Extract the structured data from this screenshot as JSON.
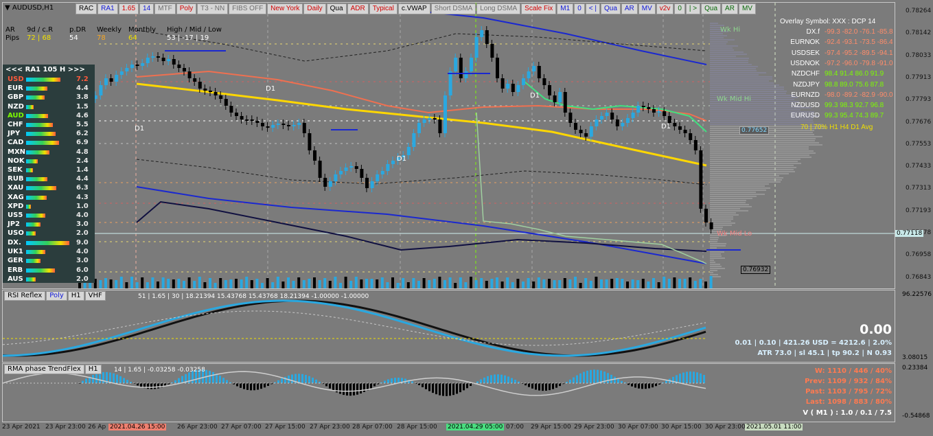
{
  "window": {
    "symbol": "AUDUSD,H1"
  },
  "toolbar": [
    {
      "label": "RAC",
      "style": ""
    },
    {
      "label": "RA1",
      "style": "blue"
    },
    {
      "label": "1.65",
      "style": "red"
    },
    {
      "label": "14",
      "style": "blue"
    },
    {
      "label": "MTF",
      "style": "grey"
    },
    {
      "label": "Poly",
      "style": "red"
    },
    {
      "label": "T3 - NN",
      "style": "grey"
    },
    {
      "label": "FIBS OFF",
      "style": "grey"
    },
    {
      "label": "New York",
      "style": "red"
    },
    {
      "label": "Daily",
      "style": "red"
    },
    {
      "label": "Qua",
      "style": ""
    },
    {
      "label": "ADR",
      "style": "red"
    },
    {
      "label": "Typical",
      "style": "red"
    },
    {
      "label": "c.VWAP",
      "style": ""
    },
    {
      "label": "Short DSMA",
      "style": "grey"
    },
    {
      "label": "Long DSMA",
      "style": "grey"
    },
    {
      "label": "Scale Fix",
      "style": "red"
    },
    {
      "label": "M1",
      "style": "blue"
    },
    {
      "label": "0",
      "style": "blue"
    },
    {
      "label": "< |",
      "style": "blue"
    },
    {
      "label": "Qua",
      "style": "blue"
    },
    {
      "label": "AR",
      "style": "blue"
    },
    {
      "label": "MV",
      "style": "blue"
    },
    {
      "label": "v2v",
      "style": "red"
    },
    {
      "label": "0",
      "style": "green"
    },
    {
      "label": "| >",
      "style": "green"
    },
    {
      "label": "Qua",
      "style": "green"
    },
    {
      "label": "AR",
      "style": "green"
    },
    {
      "label": "MV",
      "style": "green"
    }
  ],
  "stats": {
    "ar_label": "AR",
    "pips_label": "Pips",
    "col1_head": "9d / c.R",
    "col1_val": "72 | 68",
    "col2_head": "p.DR",
    "col2_val": "54",
    "col3_head": "Weekly",
    "col3_val": "78",
    "col4_head": "Monthly",
    "col4_val": "64",
    "col5_head": "High / Mid / Low",
    "col5_val": "53  |  -17  |  19"
  },
  "strength": {
    "header": "<<<   RA1   105   H   >>>",
    "rows": [
      {
        "name": "USD",
        "value": "7.2",
        "style": "red",
        "fill": 0.72
      },
      {
        "name": "EUR",
        "value": "4.4",
        "style": "",
        "fill": 0.44
      },
      {
        "name": "GBP",
        "value": "3.8",
        "style": "",
        "fill": 0.38
      },
      {
        "name": "NZD",
        "value": "1.5",
        "style": "",
        "fill": 0.15
      },
      {
        "name": "AUD",
        "value": "4.6",
        "style": "green",
        "fill": 0.46
      },
      {
        "name": "CHF",
        "value": "5.5",
        "style": "",
        "fill": 0.55
      },
      {
        "name": "JPY",
        "value": "6.2",
        "style": "",
        "fill": 0.62
      },
      {
        "name": "CAD",
        "value": "6.9",
        "style": "",
        "fill": 0.69
      },
      {
        "name": "MXN",
        "value": "4.8",
        "style": "",
        "fill": 0.48
      },
      {
        "name": "NOK",
        "value": "2.4",
        "style": "",
        "fill": 0.24
      },
      {
        "name": "SEK",
        "value": "1.4",
        "style": "",
        "fill": 0.14
      },
      {
        "name": "RUB",
        "value": "4.4",
        "style": "",
        "fill": 0.44
      },
      {
        "name": "XAU",
        "value": "6.3",
        "style": "",
        "fill": 0.63
      },
      {
        "name": "XAG",
        "value": "4.3",
        "style": "",
        "fill": 0.43
      },
      {
        "name": "XPD",
        "value": "1.0",
        "style": "",
        "fill": 0.1
      },
      {
        "name": "US5",
        "value": "4.0",
        "style": "",
        "fill": 0.4
      },
      {
        "name": "JP2",
        "value": "3.0",
        "style": "",
        "fill": 0.3
      },
      {
        "name": "USO",
        "value": "2.0",
        "style": "",
        "fill": 0.2
      },
      {
        "name": "DX.",
        "value": "9.0",
        "style": "",
        "fill": 0.9
      },
      {
        "name": "UK1",
        "value": "4.0",
        "style": "",
        "fill": 0.4
      },
      {
        "name": "GER",
        "value": "3.0",
        "style": "",
        "fill": 0.3
      },
      {
        "name": "ERB",
        "value": "6.0",
        "style": "",
        "fill": 0.6
      },
      {
        "name": "AUS",
        "value": "2.0",
        "style": "",
        "fill": 0.2
      }
    ]
  },
  "overlay": {
    "title": "Overlay Symbol: XXX : DCP 14",
    "rows": [
      {
        "name": "DX.f",
        "vals": "-99.3  -82.0  -76.1  -85.8",
        "color": "#ff8c6a"
      },
      {
        "name": "EURNOK",
        "vals": "-92.4  -93.1  -73.5  -86.4",
        "color": "#ff8c6a"
      },
      {
        "name": "USDSEK",
        "vals": "-97.4  -95.2  -89.5  -94.1",
        "color": "#ff8c6a"
      },
      {
        "name": "USDNOK",
        "vals": "-97.2  -96.0  -79.8  -91.0",
        "color": "#ff8c6a"
      },
      {
        "name": "NZDCHF",
        "vals": "98.4  91.4  86.0  91.9",
        "color": "#7cfc00"
      },
      {
        "name": "NZDJPY",
        "vals": "98.8  89.0  75.6  87.8",
        "color": "#7cfc00"
      },
      {
        "name": "EURNZD",
        "vals": "-98.0  -89.2  -82.9  -90.0",
        "color": "#ff8c6a"
      },
      {
        "name": "NZDUSD",
        "vals": "99.3  98.3  92.7  96.8",
        "color": "#7cfc00"
      },
      {
        "name": "EURUSD",
        "vals": "99.3  95.4  74.3  89.7",
        "color": "#7cfc00"
      }
    ],
    "footer": "70  |  70%       H1      H4      D1    Avg"
  },
  "labels": {
    "wk_hi": "Wk Hi",
    "wk_mid_hi": "Wk Mid Hi",
    "wk_mid_lo": "Wk Mid Lo",
    "d1": "D1"
  },
  "price_axis": [
    "0.78264",
    "0.78142",
    "0.78033",
    "0.77913",
    "0.77793",
    "0.77676",
    "0.77553",
    "0.77433",
    "0.77313",
    "0.77193",
    "0.77078",
    "0.76958",
    "0.76843"
  ],
  "price_boxes": {
    "current": "0.77652",
    "bid": "0.77118",
    "low": "0.76932"
  },
  "rsi": {
    "tabs": [
      "RSI Reflex",
      "Poly",
      "H1",
      "VHF"
    ],
    "info": "51  |  1.65  |  30  |  18.21394  15.43768  15.43768  18.21394  -1.00000  -1.00000",
    "axis_top": "96.22576",
    "axis_bottom": "3.08015",
    "big_value": "0.00",
    "line1": "0.01   |   0.10   |   421.26 USD = 4212.6   |   2.0%",
    "line2": "ATR 73.0   |  sl 45.1   |   tp 90.2   |   N 0.93"
  },
  "rma": {
    "tabs": [
      "RMA phase TrendFlex",
      "H1"
    ],
    "info": "14  |  1.65  |  -0.03258  -0.03258",
    "axis_top": "0.23384",
    "axis_bottom": "-0.54868",
    "w": "W: 1110 / 446 / 40%",
    "prev": "Prev: 1109 / 932 / 84%",
    "past": "Past: 1103 / 795 / 72%",
    "last": "Last: 1098 / 883 / 80%",
    "v": "V ( M1 ) : 1.0 / 0.1 / 7.5"
  },
  "time_axis": [
    {
      "label": "23 Apr 2021",
      "style": ""
    },
    {
      "label": "23 Apr 23:00",
      "style": ""
    },
    {
      "label": "26 Ap",
      "style": ""
    },
    {
      "label": "2021.04.26 15:00",
      "style": "hl"
    },
    {
      "label": "26 Apr 23:00",
      "style": ""
    },
    {
      "label": "27 Apr 07:00",
      "style": ""
    },
    {
      "label": "27 Apr 15:00",
      "style": ""
    },
    {
      "label": "27 Apr 23:00",
      "style": ""
    },
    {
      "label": "28 Apr 07:00",
      "style": ""
    },
    {
      "label": "28 Apr 15:00",
      "style": ""
    },
    {
      "label": "2021.04.29 05:00",
      "style": "hlg"
    },
    {
      "label": "07:00",
      "style": ""
    },
    {
      "label": "29 Apr 15:00",
      "style": ""
    },
    {
      "label": "29 Apr 23:00",
      "style": ""
    },
    {
      "label": "30 Apr 07:00",
      "style": ""
    },
    {
      "label": "30 Apr 15:00",
      "style": ""
    },
    {
      "label": "30 Apr 23:00",
      "style": ""
    },
    {
      "label": "2021.05.01 11:00",
      "style": "hlc"
    }
  ]
}
